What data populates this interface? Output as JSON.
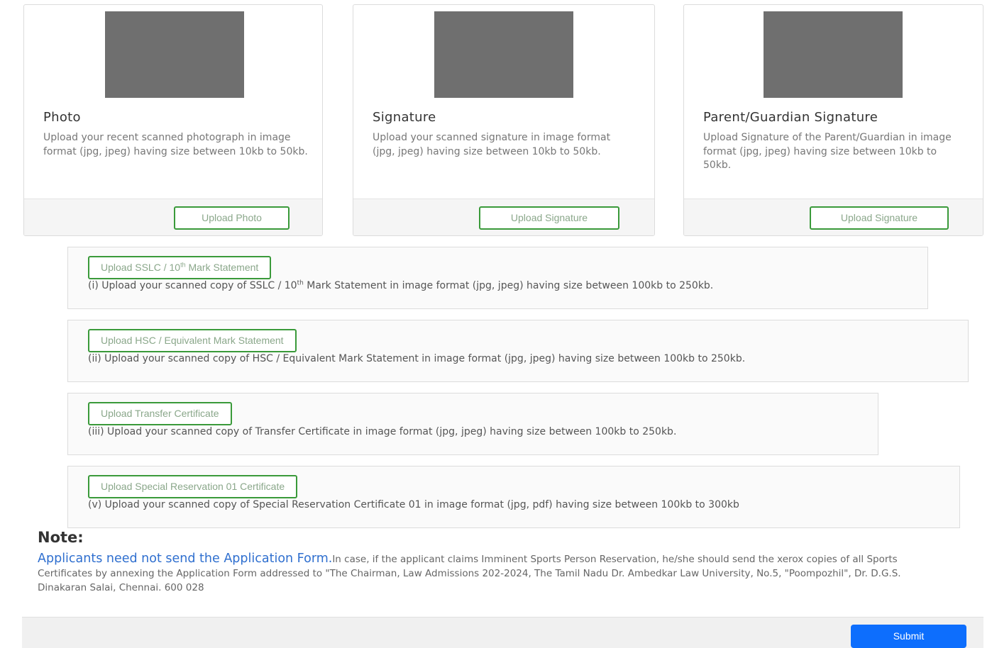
{
  "cards": [
    {
      "title": "Photo",
      "description": "Upload your recent scanned photograph in image format (jpg, jpeg) having size between 10kb to 50kb.",
      "button": "Upload Photo"
    },
    {
      "title": "Signature",
      "description": "Upload your scanned signature in image format (jpg, jpeg) having size between 10kb to 50kb.",
      "button": "Upload Signature"
    },
    {
      "title": "Parent/Guardian Signature",
      "description": "Upload Signature of the Parent/Guardian in image format (jpg, jpeg) having size between 10kb to 50kb.",
      "button": "Upload Signature"
    }
  ],
  "documents": [
    {
      "button_pre": "Upload SSLC / 10",
      "button_sup": "th",
      "button_post": " Mark Statement",
      "hint_pre": "(i) Upload your scanned copy of SSLC / 10",
      "hint_sup": "th",
      "hint_post": " Mark Statement in image format (jpg, jpeg) having size between 100kb to 250kb."
    },
    {
      "button": "Upload HSC / Equivalent Mark Statement",
      "hint": "(ii) Upload your scanned copy of HSC / Equivalent Mark Statement in image format (jpg, jpeg) having size between 100kb to 250kb."
    },
    {
      "button": "Upload Transfer Certificate",
      "hint": "(iii) Upload your scanned copy of Transfer Certificate in image format (jpg, jpeg) having size between 100kb to 250kb."
    },
    {
      "button": "Upload Special Reservation 01 Certificate",
      "hint": "(v) Upload your scanned copy of Special Reservation Certificate 01 in image format (jpg, pdf) having size between 100kb to 300kb"
    }
  ],
  "note": {
    "heading": "Note:",
    "highlight": "Applicants need not send the Application Form.",
    "text": "In case, if the applicant claims Imminent Sports Person Reservation, he/she should send the xerox copies of all Sports Certificates by annexing the Application Form addressed to \"The Chairman, Law Admissions 202-2024, The Tamil Nadu Dr. Ambedkar Law University, No.5, \"Poompozhil\", Dr. D.G.S. Dinakaran Salai, Chennai. 600 028"
  },
  "submit_label": "Submit",
  "colors": {
    "primary": "#0d6efd",
    "outline_green": "#3a9a3a",
    "note_link": "#2f6fcf",
    "placeholder_gray": "#6f6f6f"
  }
}
